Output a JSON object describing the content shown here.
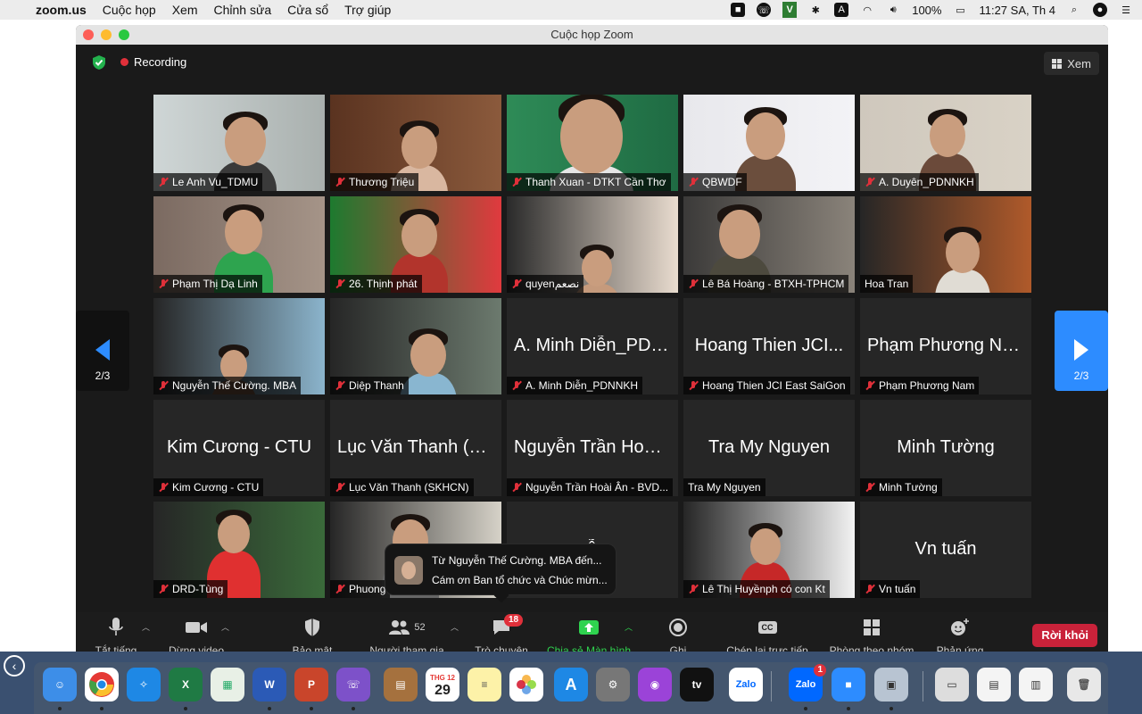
{
  "menubar": {
    "app": "zoom.us",
    "items": [
      "Cuộc họp",
      "Xem",
      "Chỉnh sửa",
      "Cửa sổ",
      "Trợ giúp"
    ],
    "tray_letter": "V",
    "input_source": "A",
    "battery": "100%",
    "clock": "11:27 SA, Th 4"
  },
  "window": {
    "title": "Cuộc họp Zoom",
    "recording": "Recording",
    "view": "Xem"
  },
  "pager": {
    "left": "2/3",
    "right": "2/3"
  },
  "tiles": [
    {
      "name": "Le Anh Vu_TDMU",
      "video": true,
      "muted": true
    },
    {
      "name": "Thương Triệu",
      "video": true,
      "muted": true
    },
    {
      "name": "Thanh Xuan - DTKT Cần Thơ",
      "video": true,
      "muted": true
    },
    {
      "name": "QBWDF",
      "video": true,
      "muted": true
    },
    {
      "name": "A. Duyên_PDNNKH",
      "video": true,
      "muted": true
    },
    {
      "name": "Phạm Thị Dạ Linh",
      "video": true,
      "muted": true
    },
    {
      "name": "26. Thịnh phát",
      "video": true,
      "muted": true
    },
    {
      "name": "quyenنصعم",
      "video": true,
      "muted": true
    },
    {
      "name": "Lê Bá Hoàng - BTXH-TPHCM",
      "video": true,
      "muted": true
    },
    {
      "name": "Hoa Tran",
      "video": true,
      "muted": false
    },
    {
      "name": "Nguyễn Thế Cường. MBA",
      "video": true,
      "muted": true
    },
    {
      "name": "Diệp Thanh",
      "video": true,
      "muted": true
    },
    {
      "name": "A. Minh Diễn_PDNNKH",
      "big": "A. Minh Diễn_PDN...",
      "video": false,
      "muted": true
    },
    {
      "name": "Hoang Thien JCI East SaiGon",
      "big": "Hoang Thien JCI...",
      "video": false,
      "muted": true
    },
    {
      "name": "Phạm Phương Nam",
      "big": "Phạm Phương Nam",
      "video": false,
      "muted": true
    },
    {
      "name": "Kim Cương - CTU",
      "big": "Kim Cương - CTU",
      "video": false,
      "muted": true
    },
    {
      "name": "Lục Văn Thanh (SKHCN)",
      "big": "Lục Văn Thanh (S...",
      "video": false,
      "muted": true
    },
    {
      "name": "Nguyễn Trần Hoài Ân - BVD...",
      "big": "Nguyễn Trần Hoài...",
      "video": false,
      "muted": true
    },
    {
      "name": "Tra My Nguyen",
      "big": "Tra My Nguyen",
      "video": false,
      "muted": false
    },
    {
      "name": "Minh Tường",
      "big": "Minh Tường",
      "video": false,
      "muted": true
    },
    {
      "name": "DRD-Tùng",
      "video": true,
      "muted": true
    },
    {
      "name": "Phuong",
      "video": true,
      "muted": true
    },
    {
      "name": "",
      "big": "yễn",
      "video": false,
      "muted": false
    },
    {
      "name": "Lê Thị Huyềnph có con Kt",
      "video": true,
      "muted": true
    },
    {
      "name": "Vn tuấn",
      "big": "Vn tuấn",
      "video": false,
      "muted": true
    }
  ],
  "notification": {
    "line1": "Từ Nguyễn Thế Cường. MBA đến...",
    "line2": "Cám ơn Ban tổ chức và Chúc mừn..."
  },
  "toolbar": {
    "mute": "Tắt tiếng",
    "video": "Dừng video",
    "security": "Bảo mật",
    "participants": "Người tham gia",
    "participants_count": "52",
    "chat": "Trò chuyện",
    "chat_badge": "18",
    "share": "Chia sẻ Màn hình",
    "record": "Ghi",
    "cc_icon": "CC",
    "cc": "Chép lại trực tiếp",
    "breakout": "Phòng theo nhóm",
    "reactions": "Phản ứng",
    "leave": "Rời khỏi"
  },
  "dock": {
    "calendar_month": "THG 12",
    "calendar_day": "29",
    "zalo_label": "Zalo",
    "zalo_badge": "1",
    "appletv_label": "tv"
  }
}
